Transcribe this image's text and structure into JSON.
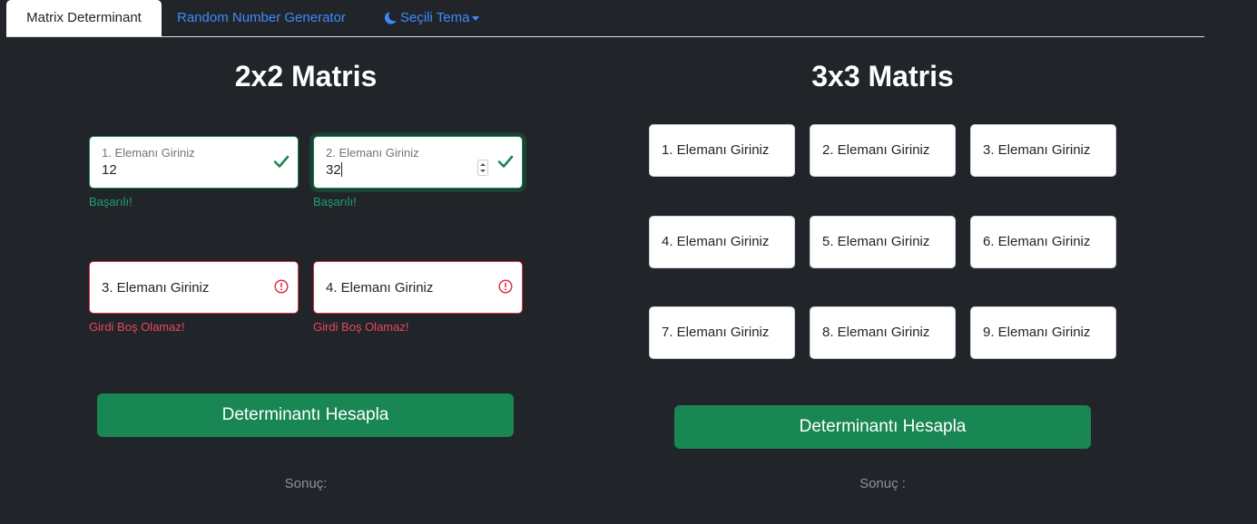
{
  "tabs": {
    "matrix": "Matrix Determinant",
    "random": "Random Number Generator",
    "theme": "Seçili Tema"
  },
  "matrix2": {
    "title": "2x2 Matris",
    "fields": [
      {
        "label": "1. Elemanı Giriniz",
        "value": "12",
        "feedback": "Başarılı!"
      },
      {
        "label": "2. Elemanı Giriniz",
        "value": "32",
        "feedback": "Başarılı!"
      },
      {
        "label": "3. Elemanı Giriniz",
        "value": "",
        "feedback": "Girdi Boş Olamaz!"
      },
      {
        "label": "4. Elemanı Giriniz",
        "value": "",
        "feedback": "Girdi Boş Olamaz!"
      }
    ],
    "button": "Determinantı Hesapla",
    "result": "Sonuç:"
  },
  "matrix3": {
    "title": "3x3 Matris",
    "cells": [
      "1. Elemanı Giriniz",
      "2. Elemanı Giriniz",
      "3. Elemanı Giriniz",
      "4. Elemanı Giriniz",
      "5. Elemanı Giriniz",
      "6. Elemanı Giriniz",
      "7. Elemanı Giriniz",
      "8. Elemanı Giriniz",
      "9. Elemanı Giriniz"
    ],
    "button": "Determinantı Hesapla",
    "result": "Sonuç :"
  },
  "colors": {
    "success": "#198754",
    "danger": "#dc3545",
    "link": "#3d8bfd",
    "background": "#212529"
  }
}
